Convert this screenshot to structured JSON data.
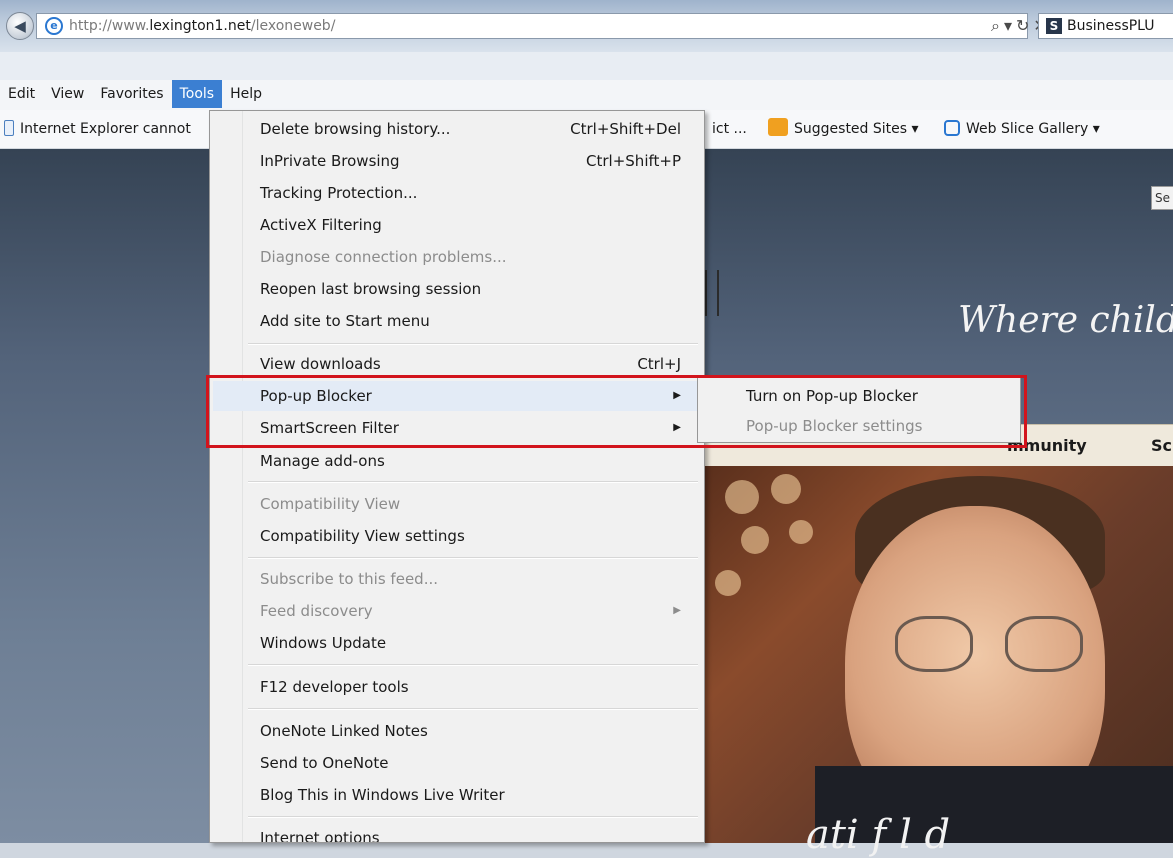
{
  "browser": {
    "url_prefix": "http://www.",
    "url_domain": "lexington1.net",
    "url_path": "/lexoneweb/",
    "address_controls": "⌕▾↻✕",
    "tab_icon": "S",
    "tab_label": "BusinessPLU"
  },
  "menubar": {
    "items": [
      "Edit",
      "View",
      "Favorites",
      "Tools",
      "Help"
    ],
    "active": "Tools"
  },
  "favorites_bar": {
    "ie_warning": "Internet Explorer cannot",
    "truncated_item": "ict ...",
    "suggested_sites": "Suggested Sites ▾",
    "web_slice_gallery": "Web Slice Gallery ▾"
  },
  "tools_menu": {
    "items": [
      {
        "label": "Delete browsing history...",
        "shortcut": "Ctrl+Shift+Del",
        "disabled": false
      },
      {
        "label": "InPrivate Browsing",
        "shortcut": "Ctrl+Shift+P",
        "disabled": false
      },
      {
        "label": "Tracking Protection...",
        "disabled": false
      },
      {
        "label": "ActiveX Filtering",
        "disabled": false
      },
      {
        "label": "Diagnose connection problems...",
        "disabled": true
      },
      {
        "label": "Reopen last browsing session",
        "disabled": false
      },
      {
        "label": "Add site to Start menu",
        "disabled": false
      },
      {
        "label": "View downloads",
        "shortcut": "Ctrl+J",
        "disabled": false
      },
      {
        "label": "Pop-up Blocker",
        "submenu": true,
        "disabled": false
      },
      {
        "label": "SmartScreen Filter",
        "submenu": true,
        "disabled": false
      },
      {
        "label": "Manage add-ons",
        "disabled": false
      },
      {
        "label": "Compatibility View",
        "disabled": true
      },
      {
        "label": "Compatibility View settings",
        "disabled": false
      },
      {
        "label": "Subscribe to this feed...",
        "disabled": true
      },
      {
        "label": "Feed discovery",
        "submenu": true,
        "disabled": true
      },
      {
        "label": "Windows Update",
        "disabled": false
      },
      {
        "label": "F12 developer tools",
        "disabled": false
      },
      {
        "label": "OneNote Linked Notes",
        "disabled": false
      },
      {
        "label": "Send to OneNote",
        "disabled": false
      },
      {
        "label": "Blog This in Windows Live Writer",
        "disabled": false
      },
      {
        "label": "Internet options",
        "disabled": false
      }
    ]
  },
  "popup_submenu": {
    "items": [
      {
        "label": "Turn on Pop-up Blocker",
        "disabled": false
      },
      {
        "label": "Pop-up Blocker settings",
        "disabled": true
      }
    ]
  },
  "website": {
    "search_fragment": "Se",
    "tagline_fragment": "Where childre",
    "nav_community": "mmunity",
    "nav_next": "Sc",
    "bottom_fragment": "ati   f l   d"
  },
  "colors": {
    "menu_active": "#3b7fd2",
    "highlight_box": "#d2141c",
    "menu_hover": "#e3ebf6"
  }
}
